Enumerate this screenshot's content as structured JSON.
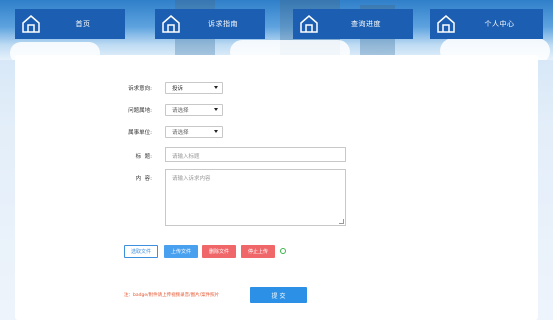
{
  "nav": [
    {
      "label": "首页",
      "icon": "home-icon"
    },
    {
      "label": "诉求指南",
      "icon": "home-icon"
    },
    {
      "label": "查询进度",
      "icon": "home-icon"
    },
    {
      "label": "个人中心",
      "icon": "home-icon"
    }
  ],
  "form": {
    "type_label": "诉求意向:",
    "type_value": "投诉",
    "category_label": "问题属地:",
    "category_value": "请选择",
    "dept_label": "属事单位:",
    "dept_value": "请选择",
    "title_label": "标  题:",
    "title_placeholder": "请输入标题",
    "content_label": "内  容:",
    "content_placeholder": "请输入诉求内容"
  },
  "upload": {
    "select_label": "选取文件",
    "upload_label": "上传文件",
    "delete_label": "删除文件",
    "stop_label": "停止上传"
  },
  "note": "注：badge/附件请上传视频录音/图片/案件照片",
  "submit_label": "提 交",
  "colors": {
    "nav": "#1c5fb2",
    "primary": "#2b90e6",
    "danger": "#f0676a",
    "note": "#e4542d"
  }
}
